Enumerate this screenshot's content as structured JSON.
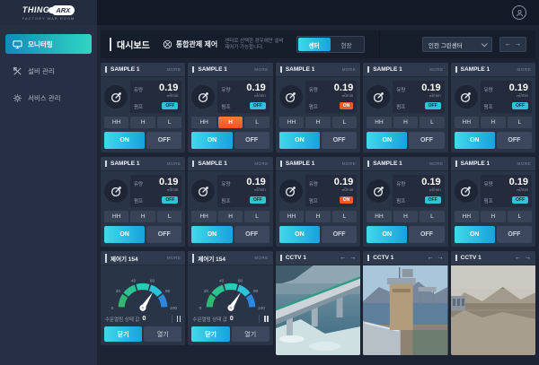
{
  "header": {
    "logo_title": "THING",
    "logo_badge": "ARX",
    "logo_subtitle": "FACTORY WAR ROOM"
  },
  "sidebar": {
    "items": [
      {
        "label": "모니터링",
        "icon": "monitor",
        "active": true
      },
      {
        "label": "설비 관리",
        "icon": "equipment",
        "active": false
      },
      {
        "label": "서비스 관리",
        "icon": "service",
        "active": false
      }
    ]
  },
  "topbar": {
    "title": "대시보드",
    "control_label": "통합관제 제어",
    "note_line1": "센터로 선택한 경우에만 설비",
    "note_line2": "제어가 가능합니다.",
    "toggle_center": "센터",
    "toggle_field": "현장",
    "site_selected": "인천 그린센터",
    "nav_prev": "←",
    "nav_next": "→"
  },
  "sample_card": {
    "title": "SAMPLE 1",
    "more": "MORE",
    "flow_label": "유량",
    "flow_value": "0.19",
    "flow_unit": "㎥/min",
    "pump_label": "펌프",
    "levels": [
      "HH",
      "H",
      "L"
    ],
    "on_label": "ON",
    "off_label": "OFF"
  },
  "sample_rows": [
    [
      {
        "pump": "OFF",
        "active_level": null,
        "power": "ON"
      },
      {
        "pump": "OFF",
        "active_level": "H",
        "power": "ON"
      },
      {
        "pump": "ON",
        "active_level": null,
        "power": "ON"
      },
      {
        "pump": "OFF",
        "active_level": null,
        "power": "ON"
      },
      {
        "pump": "OFF",
        "active_level": null,
        "power": "ON"
      }
    ],
    [
      {
        "pump": "OFF",
        "active_level": null,
        "power": "ON"
      },
      {
        "pump": "OFF",
        "active_level": null,
        "power": "ON"
      },
      {
        "pump": "ON",
        "active_level": null,
        "power": "ON"
      },
      {
        "pump": "OFF",
        "active_level": null,
        "power": "ON"
      },
      {
        "pump": "OFF",
        "active_level": null,
        "power": "ON"
      }
    ]
  ],
  "controller_cards": {
    "count": 2,
    "title": "제어기 154",
    "more": "MORE",
    "gauge": {
      "min": 0,
      "max": 100,
      "ticks": [
        0,
        20,
        40,
        60,
        80,
        100
      ],
      "value": 68
    },
    "status_label": "수문열림 상태 값",
    "status_value": "0",
    "close_label": "닫기",
    "open_label": "열기"
  },
  "cctv": {
    "title": "CCTV 1",
    "prev": "←",
    "next": "→",
    "scenes": [
      "dam-bridge-spillway",
      "dam-control-structure",
      "reservoir-hills"
    ]
  },
  "colors": {
    "accent_cyan": "#2fc3da",
    "accent_cyan_deep": "#17a3dc",
    "accent_orange": "#f15a24",
    "sidebar_active_gradient": [
      "#1489b8",
      "#2fd6c3"
    ],
    "gauge_segments": [
      "#2eb872",
      "#2bc490",
      "#28cdb4",
      "#2ac4dc",
      "#2f86dd"
    ],
    "card_bg": "#2a3447",
    "main_bg": "#1c2332"
  }
}
